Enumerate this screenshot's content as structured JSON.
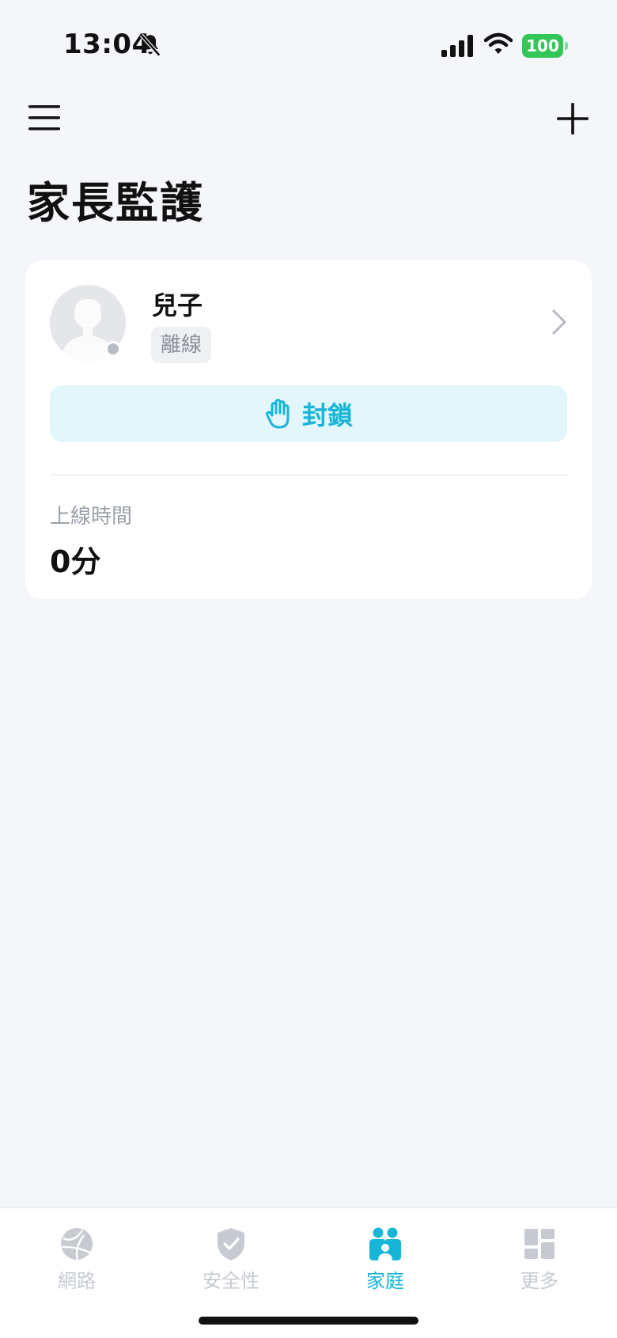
{
  "status_bar": {
    "time": "13:04",
    "battery": "100",
    "icons": [
      "bell-slash-icon",
      "signal-icon",
      "wifi-icon",
      "battery-icon"
    ]
  },
  "header": {
    "title": "家長監護",
    "menu_icon": "hamburger-icon",
    "add_icon": "plus-icon"
  },
  "profile_card": {
    "name": "兒子",
    "status": "離線",
    "block_label": "封鎖",
    "online_time_label": "上線時間",
    "online_time_value": "0分"
  },
  "tabs": [
    {
      "label": "網路",
      "icon": "globe-icon",
      "active": false
    },
    {
      "label": "安全性",
      "icon": "shield-check-icon",
      "active": false
    },
    {
      "label": "家庭",
      "icon": "family-icon",
      "active": true
    },
    {
      "label": "更多",
      "icon": "grid-icon",
      "active": false
    }
  ],
  "colors": {
    "accent": "#17b5d8",
    "background": "#f4f6fa",
    "battery": "#33c759",
    "inactive": "#c7cbd1"
  }
}
